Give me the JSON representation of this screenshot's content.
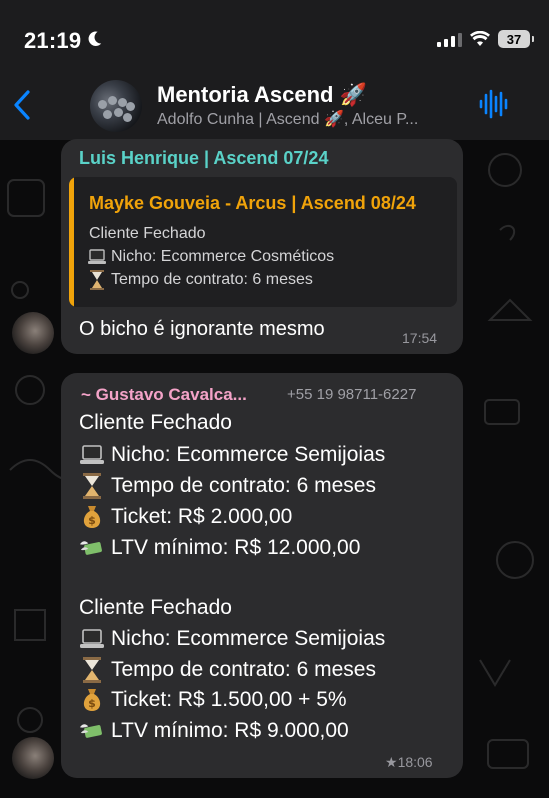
{
  "status_bar": {
    "time": "21:19",
    "battery": "37"
  },
  "header": {
    "title": "Mentoria Ascend 🚀",
    "subtitle": "Adolfo Cunha | Ascend 🚀, Alceu P..."
  },
  "messages": [
    {
      "sender": "Luis Henrique | Ascend 07/24",
      "quote": {
        "author": "Mayke Gouveia - Arcus | Ascend 08/24",
        "lines": [
          {
            "icon": "",
            "text": "Cliente Fechado"
          },
          {
            "icon": "laptop-icon",
            "text": "Nicho: Ecommerce Cosméticos"
          },
          {
            "icon": "hourglass-icon",
            "text": "Tempo de contrato: 6 meses"
          }
        ]
      },
      "text": "O bicho é ignorante mesmo",
      "time": "17:54"
    },
    {
      "sender": "~ Gustavo Cavalca...",
      "phone": "+55 19 98711-6227",
      "blocks": [
        {
          "title": "Cliente Fechado",
          "lines": [
            {
              "icon": "laptop-icon",
              "text": "Nicho: Ecommerce Semijoias"
            },
            {
              "icon": "hourglass-icon",
              "text": "Tempo de contrato: 6 meses"
            },
            {
              "icon": "money-bag-icon",
              "text": "Ticket: R$ 2.000,00"
            },
            {
              "icon": "money-wings-icon",
              "text": "LTV mínimo: R$ 12.000,00"
            }
          ]
        },
        {
          "title": "Cliente Fechado",
          "lines": [
            {
              "icon": "laptop-icon",
              "text": "Nicho: Ecommerce Semijoias"
            },
            {
              "icon": "hourglass-icon",
              "text": "Tempo de contrato: 6 meses"
            },
            {
              "icon": "money-bag-icon",
              "text": "Ticket: R$ 1.500,00 + 5%"
            },
            {
              "icon": "money-wings-icon",
              "text": "LTV mínimo: R$ 9.000,00"
            }
          ]
        }
      ],
      "time": "18:06",
      "starred": "★"
    }
  ],
  "colors": {
    "bubble": "#2c2c2e",
    "sender1": "#5ad2c8",
    "quote_author": "#f0a30a",
    "sender2": "#f4a3c8",
    "accent": "#0a84ff"
  }
}
